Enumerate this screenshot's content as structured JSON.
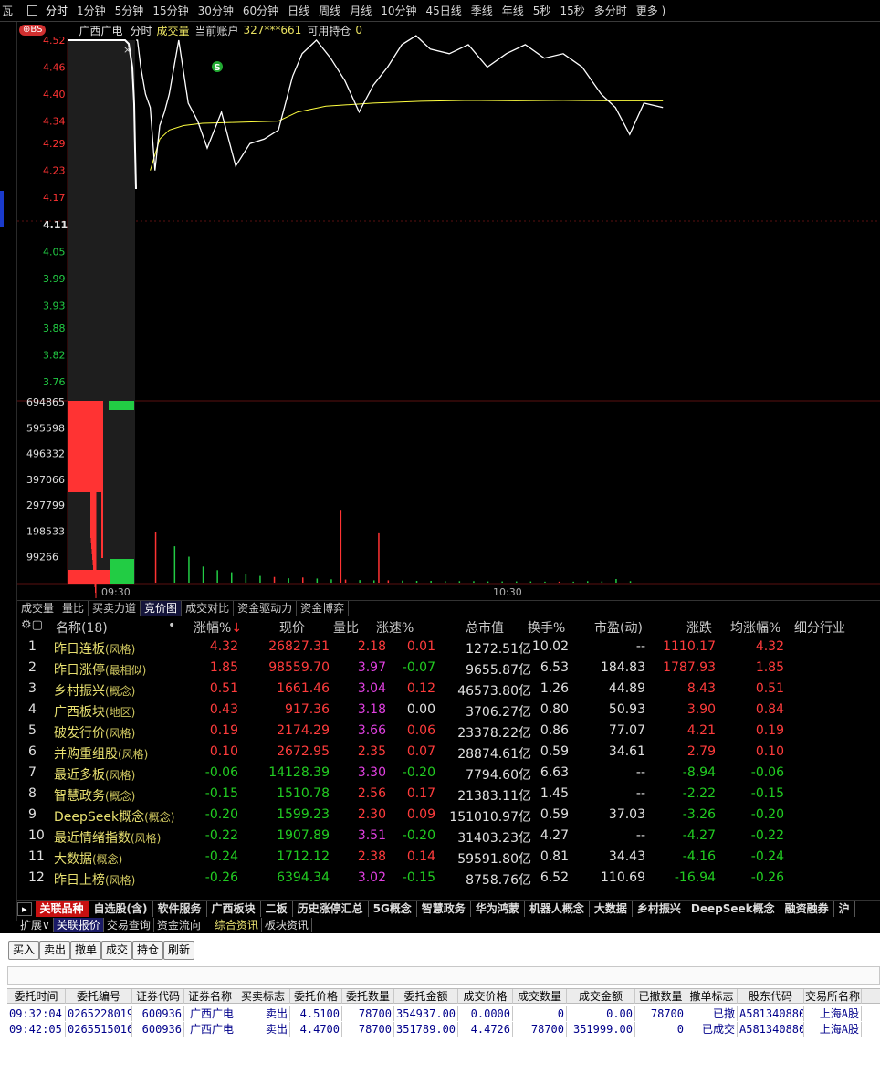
{
  "topbar": {
    "first_label": "瓦",
    "periods": [
      "分时",
      "1分钟",
      "5分钟",
      "15分钟",
      "30分钟",
      "60分钟",
      "日线",
      "周线",
      "月线",
      "10分钟",
      "45日线",
      "季线",
      "年线",
      "5秒",
      "15秒",
      "多分时",
      "更多 )"
    ],
    "active": "分时"
  },
  "chart": {
    "badge": "BS",
    "stock_name": "广西广电",
    "mode": "分时",
    "volume_label": "成交量",
    "account_label": "当前账户",
    "account_masked": "327***661",
    "holdings_label": "可用持仓",
    "holdings_value": "0",
    "signal_marker": "S",
    "price_ticks": [
      {
        "v": "4.52",
        "c": "red"
      },
      {
        "v": "4.46",
        "c": "red"
      },
      {
        "v": "4.40",
        "c": "red"
      },
      {
        "v": "4.34",
        "c": "red"
      },
      {
        "v": "4.29",
        "c": "red"
      },
      {
        "v": "4.23",
        "c": "red"
      },
      {
        "v": "4.17",
        "c": "red"
      },
      {
        "v": "4.11",
        "c": "white"
      },
      {
        "v": "4.05",
        "c": "green"
      },
      {
        "v": "3.99",
        "c": "green"
      },
      {
        "v": "3.93",
        "c": "green"
      },
      {
        "v": "3.88",
        "c": "green"
      },
      {
        "v": "3.82",
        "c": "green"
      },
      {
        "v": "3.76",
        "c": "green"
      }
    ],
    "volume_ticks": [
      "694865",
      "595598",
      "496332",
      "397066",
      "297799",
      "198533",
      "99266"
    ],
    "time_ticks": [
      "09:30",
      "10:30"
    ],
    "price_line": [
      [
        0,
        4.52
      ],
      [
        0.3,
        4.52
      ],
      [
        1,
        4.46
      ],
      [
        2,
        4.4
      ],
      [
        3,
        4.37
      ],
      [
        4,
        4.23
      ],
      [
        5,
        4.33
      ],
      [
        6,
        4.36
      ],
      [
        7,
        4.4
      ],
      [
        8,
        4.46
      ],
      [
        9,
        4.52
      ],
      [
        11,
        4.38
      ],
      [
        13,
        4.34
      ],
      [
        15,
        4.28
      ],
      [
        18,
        4.36
      ],
      [
        21,
        4.24
      ],
      [
        24,
        4.29
      ],
      [
        27,
        4.3
      ],
      [
        30,
        4.32
      ],
      [
        33,
        4.44
      ],
      [
        35,
        4.49
      ],
      [
        38,
        4.52
      ],
      [
        41,
        4.48
      ],
      [
        44,
        4.43
      ],
      [
        47,
        4.36
      ],
      [
        50,
        4.42
      ],
      [
        53,
        4.46
      ],
      [
        56,
        4.51
      ],
      [
        59,
        4.53
      ],
      [
        62,
        4.5
      ],
      [
        66,
        4.49
      ],
      [
        70,
        4.51
      ],
      [
        74,
        4.46
      ],
      [
        78,
        4.49
      ],
      [
        82,
        4.51
      ],
      [
        86,
        4.48
      ],
      [
        90,
        4.49
      ],
      [
        94,
        4.46
      ],
      [
        98,
        4.4
      ],
      [
        101,
        4.37
      ],
      [
        104,
        4.31
      ],
      [
        107,
        4.38
      ],
      [
        111,
        4.37
      ]
    ],
    "avg_line": [
      [
        3,
        4.23
      ],
      [
        5,
        4.3
      ],
      [
        7,
        4.32
      ],
      [
        10,
        4.33
      ],
      [
        14,
        4.335
      ],
      [
        20,
        4.337
      ],
      [
        30,
        4.34
      ],
      [
        34,
        4.36
      ],
      [
        40,
        4.373
      ],
      [
        50,
        4.38
      ],
      [
        60,
        4.384
      ],
      [
        70,
        4.386
      ],
      [
        80,
        4.385
      ],
      [
        90,
        4.386
      ],
      [
        100,
        4.385
      ],
      [
        111,
        4.385
      ]
    ],
    "volume_bars": [
      {
        "m": 4,
        "v": 195000,
        "c": "red"
      },
      {
        "m": 8,
        "v": 140000,
        "c": "green"
      },
      {
        "m": 11,
        "v": 100000,
        "c": "green"
      },
      {
        "m": 14,
        "v": 62000,
        "c": "green"
      },
      {
        "m": 17,
        "v": 48000,
        "c": "green"
      },
      {
        "m": 20,
        "v": 40000,
        "c": "green"
      },
      {
        "m": 23,
        "v": 32000,
        "c": "green"
      },
      {
        "m": 26,
        "v": 26000,
        "c": "green"
      },
      {
        "m": 29,
        "v": 22000,
        "c": "red"
      },
      {
        "m": 32,
        "v": 17000,
        "c": "green"
      },
      {
        "m": 35,
        "v": 20000,
        "c": "red"
      },
      {
        "m": 38,
        "v": 16000,
        "c": "green"
      },
      {
        "m": 41,
        "v": 13000,
        "c": "green"
      },
      {
        "m": 44,
        "v": 12000,
        "c": "red"
      },
      {
        "m": 47,
        "v": 10000,
        "c": "green"
      },
      {
        "m": 50,
        "v": 9000,
        "c": "green"
      },
      {
        "m": 53,
        "v": 9000,
        "c": "red"
      },
      {
        "m": 56,
        "v": 8000,
        "c": "green"
      },
      {
        "m": 59,
        "v": 7000,
        "c": "green"
      },
      {
        "m": 62,
        "v": 7000,
        "c": "green"
      },
      {
        "m": 65,
        "v": 6000,
        "c": "green"
      },
      {
        "m": 68,
        "v": 6000,
        "c": "green"
      },
      {
        "m": 71,
        "v": 6000,
        "c": "green"
      },
      {
        "m": 74,
        "v": 5000,
        "c": "green"
      },
      {
        "m": 77,
        "v": 5000,
        "c": "green"
      },
      {
        "m": 80,
        "v": 5000,
        "c": "green"
      },
      {
        "m": 83,
        "v": 5000,
        "c": "green"
      },
      {
        "m": 86,
        "v": 4000,
        "c": "green"
      },
      {
        "m": 89,
        "v": 4000,
        "c": "red"
      },
      {
        "m": 92,
        "v": 4000,
        "c": "green"
      },
      {
        "m": 95,
        "v": 6000,
        "c": "green"
      },
      {
        "m": 98,
        "v": 5000,
        "c": "green"
      },
      {
        "m": 101,
        "v": 14000,
        "c": "green"
      },
      {
        "m": 104,
        "v": 6000,
        "c": "green"
      }
    ],
    "spike_bars": [
      {
        "m": 43,
        "v": 280000,
        "c": "red"
      },
      {
        "m": 51,
        "v": 190000,
        "c": "red"
      }
    ],
    "colors": {
      "red": "#ff3333",
      "green": "#22cc44",
      "price_line": "#ffffff",
      "avg_line": "#ffff40",
      "grid": "#5a1010"
    }
  },
  "chart_tabs": [
    "成交量",
    "量比",
    "买卖力道",
    "竞价图",
    "成交对比",
    "资金驱动力",
    "资金博弈"
  ],
  "chart_tabs_active": "竞价图",
  "table": {
    "headers": {
      "name": "名称(18)",
      "dot": "•",
      "chg": "涨幅%",
      "price": "现价",
      "vr": "量比",
      "speed": "涨速%",
      "mcap": "总市值",
      "turnover": "换手%",
      "pe": "市盈(动)",
      "change": "涨跌",
      "avgchg": "均涨幅%",
      "industry": "细分行业"
    },
    "sort_arrow": "↓",
    "rows": [
      {
        "idx": "1",
        "name": "昨日连板",
        "cat": "(风格)",
        "chg": "4.32",
        "price": "26827.31",
        "vr": "2.18",
        "speed": "0.01",
        "mcap": "1272.51亿",
        "turnover": "10.02",
        "pe": "--",
        "change": "1110.17",
        "avgchg": "4.32"
      },
      {
        "idx": "2",
        "name": "昨日涨停",
        "cat": "(最相似)",
        "chg": "1.85",
        "price": "98559.70",
        "vr": "3.97",
        "speed": "-0.07",
        "mcap": "9655.87亿",
        "turnover": "6.53",
        "pe": "184.83",
        "change": "1787.93",
        "avgchg": "1.85"
      },
      {
        "idx": "3",
        "name": "乡村振兴",
        "cat": "(概念)",
        "chg": "0.51",
        "price": "1661.46",
        "vr": "3.04",
        "speed": "0.12",
        "mcap": "46573.80亿",
        "turnover": "1.26",
        "pe": "44.89",
        "change": "8.43",
        "avgchg": "0.51"
      },
      {
        "idx": "4",
        "name": "广西板块",
        "cat": "(地区)",
        "chg": "0.43",
        "price": "917.36",
        "vr": "3.18",
        "speed": "0.00",
        "mcap": "3706.27亿",
        "turnover": "0.80",
        "pe": "50.93",
        "change": "3.90",
        "avgchg": "0.84"
      },
      {
        "idx": "5",
        "name": "破发行价",
        "cat": "(风格)",
        "chg": "0.19",
        "price": "2174.29",
        "vr": "3.66",
        "speed": "0.06",
        "mcap": "23378.22亿",
        "turnover": "0.86",
        "pe": "77.07",
        "change": "4.21",
        "avgchg": "0.19"
      },
      {
        "idx": "6",
        "name": "并购重组股",
        "cat": "(风格)",
        "chg": "0.10",
        "price": "2672.95",
        "vr": "2.35",
        "speed": "0.07",
        "mcap": "28874.61亿",
        "turnover": "0.59",
        "pe": "34.61",
        "change": "2.79",
        "avgchg": "0.10"
      },
      {
        "idx": "7",
        "name": "最近多板",
        "cat": "(风格)",
        "chg": "-0.06",
        "price": "14128.39",
        "vr": "3.30",
        "speed": "-0.20",
        "mcap": "7794.60亿",
        "turnover": "6.63",
        "pe": "--",
        "change": "-8.94",
        "avgchg": "-0.06"
      },
      {
        "idx": "8",
        "name": "智慧政务",
        "cat": "(概念)",
        "chg": "-0.15",
        "price": "1510.78",
        "vr": "2.56",
        "speed": "0.17",
        "mcap": "21383.11亿",
        "turnover": "1.45",
        "pe": "--",
        "change": "-2.22",
        "avgchg": "-0.15"
      },
      {
        "idx": "9",
        "name": "DeepSeek概念",
        "cat": "(概念)",
        "chg": "-0.20",
        "price": "1599.23",
        "vr": "2.30",
        "speed": "0.09",
        "mcap": "151010.97亿",
        "turnover": "0.59",
        "pe": "37.03",
        "change": "-3.26",
        "avgchg": "-0.20"
      },
      {
        "idx": "10",
        "name": "最近情绪指数",
        "cat": "(风格)",
        "chg": "-0.22",
        "price": "1907.89",
        "vr": "3.51",
        "speed": "-0.20",
        "mcap": "31403.23亿",
        "turnover": "4.27",
        "pe": "--",
        "change": "-4.27",
        "avgchg": "-0.22"
      },
      {
        "idx": "11",
        "name": "大数据",
        "cat": "(概念)",
        "chg": "-0.24",
        "price": "1712.12",
        "vr": "2.38",
        "speed": "0.14",
        "mcap": "59591.80亿",
        "turnover": "0.81",
        "pe": "34.43",
        "change": "-4.16",
        "avgchg": "-0.24"
      },
      {
        "idx": "12",
        "name": "昨日上榜",
        "cat": "(风格)",
        "chg": "-0.26",
        "price": "6394.34",
        "vr": "3.02",
        "speed": "-0.15",
        "mcap": "8758.76亿",
        "turnover": "6.52",
        "pe": "110.69",
        "change": "-16.94",
        "avgchg": "-0.26"
      }
    ]
  },
  "tagbar": {
    "icon": "▸",
    "tags": [
      "关联品种",
      "自选股(含)",
      "软件服务",
      "广西板块",
      "二板",
      "历史涨停汇总",
      "5G概念",
      "智慧政务",
      "华为鸿蒙",
      "机器人概念",
      "大数据",
      "乡村振兴",
      "DeepSeek概念",
      "融资融券",
      "沪"
    ],
    "active": "关联品种"
  },
  "panelbar": {
    "items": [
      "扩展∨",
      "关联报价",
      "交易查询",
      "资金流向",
      "综合资讯",
      "板块资讯"
    ],
    "active": "关联报价"
  },
  "trade": {
    "buttons": [
      "买入",
      "卖出",
      "撤单",
      "成交",
      "持仓",
      "刷新"
    ],
    "columns": [
      "委托时间",
      "委托编号",
      "证券代码",
      "证券名称",
      "买卖标志",
      "委托价格",
      "委托数量",
      "委托金额",
      "成交价格",
      "成交数量",
      "成交金额",
      "已撤数量",
      "撤单标志",
      "股东代码",
      "交易所名称"
    ],
    "rows": [
      [
        "09:32:04",
        "0265228019",
        "600936",
        "广西广电",
        "卖出",
        "4.5100",
        "78700",
        "354937.00",
        "0.0000",
        "0",
        "0.00",
        "78700",
        "已撤",
        "A581340880",
        "上海A股"
      ],
      [
        "09:42:05",
        "0265515016",
        "600936",
        "广西广电",
        "卖出",
        "4.4700",
        "78700",
        "351789.00",
        "4.4726",
        "78700",
        "351999.00",
        "0",
        "已成交",
        "A581340880",
        "上海A股"
      ]
    ]
  }
}
